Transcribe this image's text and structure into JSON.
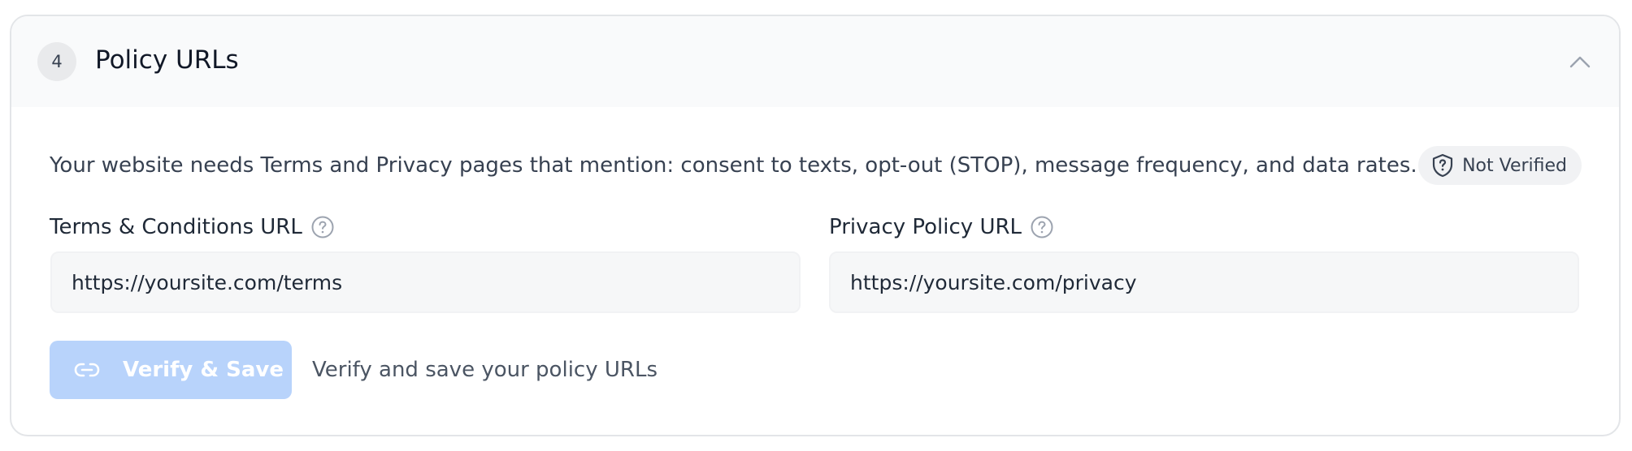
{
  "section": {
    "step_number": "4",
    "title": "Policy URLs",
    "collapse_icon": "chevron-up-icon"
  },
  "description": "Your website needs Terms and Privacy pages that mention: consent to texts, opt-out (STOP), message frequency, and data rates.",
  "status": {
    "label": "Not Verified",
    "icon": "shield-question-icon"
  },
  "fields": {
    "terms": {
      "label": "Terms & Conditions URL",
      "value": "https://yoursite.com/terms",
      "help_icon": "help-circle-icon"
    },
    "privacy": {
      "label": "Privacy Policy URL",
      "value": "https://yoursite.com/privacy",
      "help_icon": "help-circle-icon"
    }
  },
  "actions": {
    "verify_label": "Verify & Save",
    "verify_icon": "link-icon",
    "verify_hint": "Verify and save your policy URLs",
    "verify_disabled": true
  },
  "colors": {
    "button_disabled": "#b8d3fb",
    "header_bg": "#f9fafb",
    "badge_bg": "#f1f2f4"
  }
}
